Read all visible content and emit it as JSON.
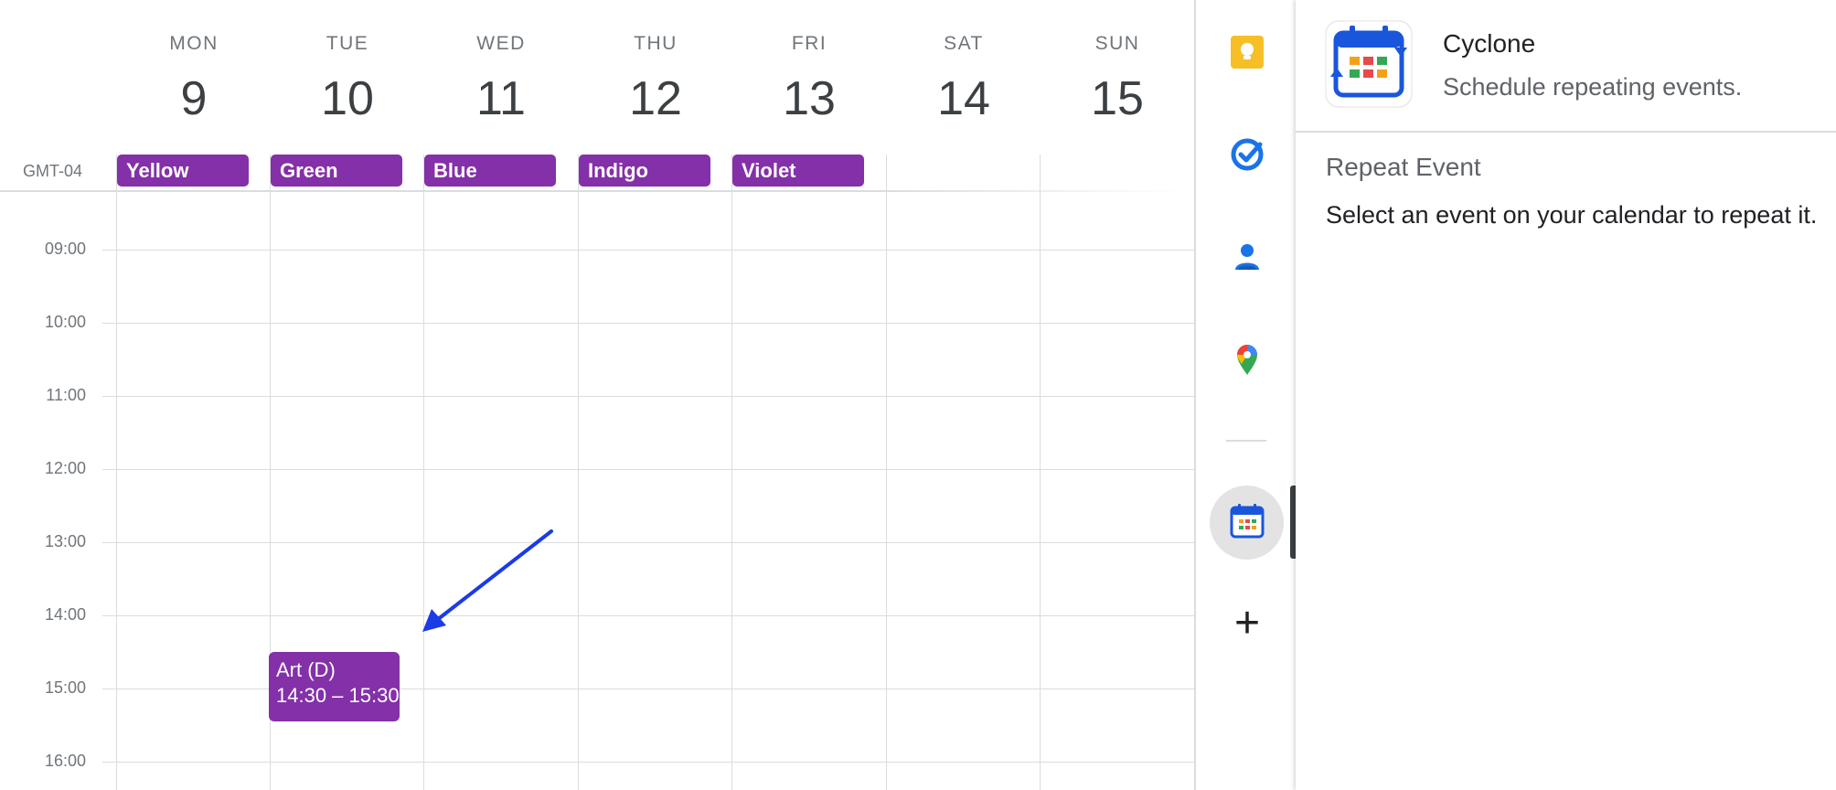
{
  "calendar": {
    "timezone": "GMT-04",
    "days": [
      {
        "name": "MON",
        "date": "9"
      },
      {
        "name": "TUE",
        "date": "10"
      },
      {
        "name": "WED",
        "date": "11"
      },
      {
        "name": "THU",
        "date": "12"
      },
      {
        "name": "FRI",
        "date": "13"
      },
      {
        "name": "SAT",
        "date": "14"
      },
      {
        "name": "SUN",
        "date": "15"
      }
    ],
    "all_day_events": [
      "Yellow",
      "Green",
      "Blue",
      "Indigo",
      "Violet"
    ],
    "hours": [
      "09:00",
      "10:00",
      "11:00",
      "12:00",
      "13:00",
      "14:00",
      "15:00",
      "16:00"
    ],
    "event": {
      "title": "Art (D)",
      "time": "14:30 – 15:30",
      "color": "#8430a8"
    }
  },
  "rail": {
    "icons": [
      "keep-icon",
      "tasks-icon",
      "contacts-icon",
      "maps-icon",
      "cyclone-app-icon"
    ],
    "add_label": "+"
  },
  "panel": {
    "app_name": "Cyclone",
    "app_tagline": "Schedule repeating events.",
    "section_title": "Repeat Event",
    "section_body": "Select an event on your calendar to repeat it."
  },
  "colors": {
    "event_purple": "#8430a8",
    "arrow_blue": "#1a3be6",
    "keep_yellow": "#f6bf26",
    "google_blue": "#1a73e8"
  }
}
